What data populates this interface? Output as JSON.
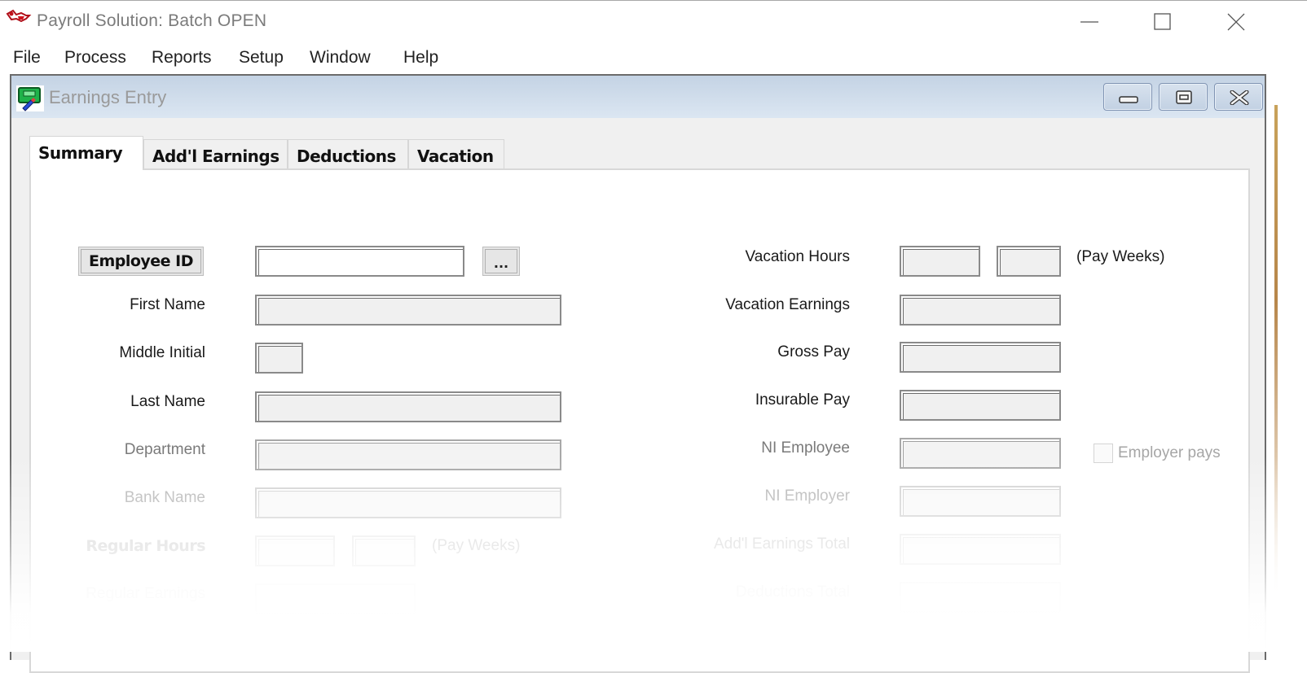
{
  "app": {
    "title": "Payroll Solution: Batch OPEN",
    "icon": "payroll-app-icon",
    "window_controls": [
      "minimize",
      "maximize",
      "close"
    ]
  },
  "menu": {
    "items": [
      {
        "label": "File"
      },
      {
        "label": "Process"
      },
      {
        "label": "Reports"
      },
      {
        "label": "Setup"
      },
      {
        "label": "Window"
      },
      {
        "label": "Help"
      }
    ]
  },
  "child_window": {
    "title": "Earnings Entry",
    "icon": "earnings-entry-icon",
    "controls": [
      "minimize",
      "restore",
      "close"
    ]
  },
  "tabs": [
    {
      "label": "Summary",
      "active": true
    },
    {
      "label": "Add'l Earnings",
      "active": false
    },
    {
      "label": "Deductions",
      "active": false
    },
    {
      "label": "Vacation",
      "active": false
    }
  ],
  "form": {
    "left": {
      "employee_id": {
        "label": "Employee ID",
        "value": "",
        "lookup_label": "..."
      },
      "first_name": {
        "label": "First Name",
        "value": ""
      },
      "middle_initial": {
        "label": "Middle Initial",
        "value": ""
      },
      "last_name": {
        "label": "Last Name",
        "value": ""
      },
      "department": {
        "label": "Department",
        "value": ""
      },
      "bank_name": {
        "label": "Bank Name",
        "value": ""
      },
      "regular_hours": {
        "label": "Regular Hours",
        "hours": "",
        "pay_weeks": "",
        "suffix": "(Pay Weeks)"
      },
      "regular_earnings": {
        "label": "Regular Earnings",
        "value": ""
      }
    },
    "right": {
      "vacation_hours": {
        "label": "Vacation Hours",
        "hours": "",
        "pay_weeks": "",
        "suffix": "(Pay Weeks)"
      },
      "vacation_earnings": {
        "label": "Vacation Earnings",
        "value": ""
      },
      "gross_pay": {
        "label": "Gross Pay",
        "value": ""
      },
      "insurable_pay": {
        "label": "Insurable Pay",
        "value": ""
      },
      "ni_employee": {
        "label": "NI Employee",
        "value": ""
      },
      "employer_pays": {
        "label": "Employer pays",
        "checked": false
      },
      "ni_employer": {
        "label": "NI Employer",
        "value": ""
      },
      "addl_earnings_total": {
        "label": "Add'l Earnings Total",
        "value": ""
      },
      "deductions_total": {
        "label": "Deductions Total",
        "value": ""
      }
    }
  }
}
